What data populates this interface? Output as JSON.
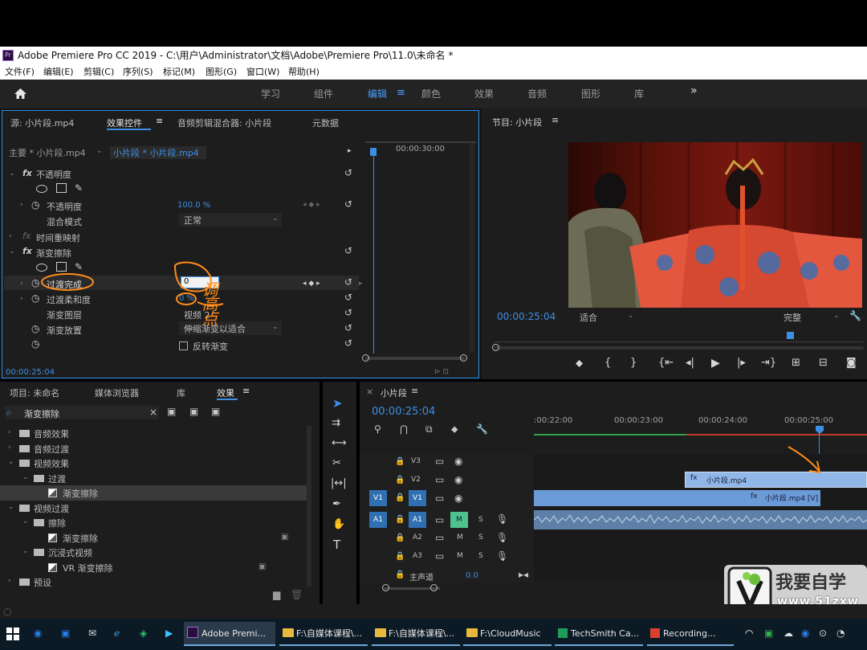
{
  "window": {
    "title": "Adobe Premiere Pro CC 2019 - C:\\用户\\Administrator\\文档\\Adobe\\Premiere Pro\\11.0\\未命名 *",
    "app_icon": "Pr"
  },
  "menu": [
    "文件(F)",
    "编辑(E)",
    "剪辑(C)",
    "序列(S)",
    "标记(M)",
    "图形(G)",
    "窗口(W)",
    "帮助(H)"
  ],
  "workspaces": {
    "tabs": [
      "学习",
      "组件",
      "编辑",
      "颜色",
      "效果",
      "音频",
      "图形",
      "库"
    ],
    "active": "编辑",
    "more": "»"
  },
  "effect_controls": {
    "tabs": [
      "源: 小片段.mp4",
      "效果控件",
      "音频剪辑混合器: 小片段",
      "元数据"
    ],
    "master_clip": "主要 * 小片段.mp4",
    "clip": "小片段 * 小片段.mp4",
    "timeline_time": "00:00:30:00",
    "opacity_section": "不透明度",
    "opacity_label": "不透明度",
    "opacity_value": "100.0 %",
    "blend_label": "混合模式",
    "blend_value": "正常",
    "time_remap": "时间重映射",
    "wipe_section": "渐变擦除",
    "transition_label": "过渡完成",
    "transition_value": "0",
    "softness_label": "过渡柔和度",
    "softness_value": "0 %",
    "layer_label": "渐变图层",
    "layer_value": "视频 2",
    "placement_label": "渐变放置",
    "placement_value": "伸缩渐变以适合",
    "invert_label": "反转渐变",
    "footer_time": "00:00:25:04"
  },
  "program_monitor": {
    "title": "节目: 小片段",
    "timecode": "00:00:25:04",
    "fit": "适合",
    "quality": "完整"
  },
  "project_panel": {
    "tabs": [
      "项目: 未命名",
      "媒体浏览器",
      "库",
      "效果"
    ],
    "search_value": "渐变擦除",
    "tree": [
      {
        "label": "音频效果",
        "level": 0,
        "kind": "folder"
      },
      {
        "label": "音频过渡",
        "level": 0,
        "kind": "folder"
      },
      {
        "label": "视频效果",
        "level": 0,
        "kind": "folder"
      },
      {
        "label": "过渡",
        "level": 1,
        "kind": "folder"
      },
      {
        "label": "渐变擦除",
        "level": 2,
        "kind": "effect",
        "selected": true
      },
      {
        "label": "视频过渡",
        "level": 0,
        "kind": "folder"
      },
      {
        "label": "擦除",
        "level": 1,
        "kind": "folder"
      },
      {
        "label": "渐变擦除",
        "level": 2,
        "kind": "transition"
      },
      {
        "label": "沉浸式视频",
        "level": 1,
        "kind": "folder"
      },
      {
        "label": "VR 渐变擦除",
        "level": 2,
        "kind": "transition"
      },
      {
        "label": "预设",
        "level": 0,
        "kind": "folder"
      }
    ]
  },
  "timeline": {
    "title": "小片段",
    "timecode": "00:00:25:04",
    "ruler": [
      "00:00:22:00",
      "00:00:23:00",
      "00:00:24:00",
      "00:00:25:00"
    ],
    "ruler_first": ":00:22:00",
    "tracks": [
      {
        "name": "V3"
      },
      {
        "name": "V2"
      },
      {
        "name": "V1",
        "source": "V1"
      },
      {
        "name": "A1",
        "source": "A1",
        "mute": "M",
        "solo": "S"
      },
      {
        "name": "A2",
        "mute": "M",
        "solo": "S"
      },
      {
        "name": "A3",
        "mute": "M",
        "solo": "S"
      }
    ],
    "master_label": "主声道",
    "master_value": "0.0",
    "clip_v2": "小片段.mp4",
    "clip_v1": "小片段.mp4 [V]"
  },
  "annotation": "调高点",
  "watermark": {
    "text": "我要自学",
    "url": "www.51zxw"
  },
  "taskbar": {
    "items": [
      "Adobe Premi...",
      "F:\\自媒体课程\\...",
      "F:\\自媒体课程\\...",
      "F:\\CloudMusic",
      "TechSmith Ca...",
      "Recording..."
    ]
  },
  "colors": {
    "accent": "#3d8fe3",
    "annotation": "#ff8c1a",
    "clip_blue": "#6b9bd6",
    "mute_green": "#4ec18f"
  }
}
